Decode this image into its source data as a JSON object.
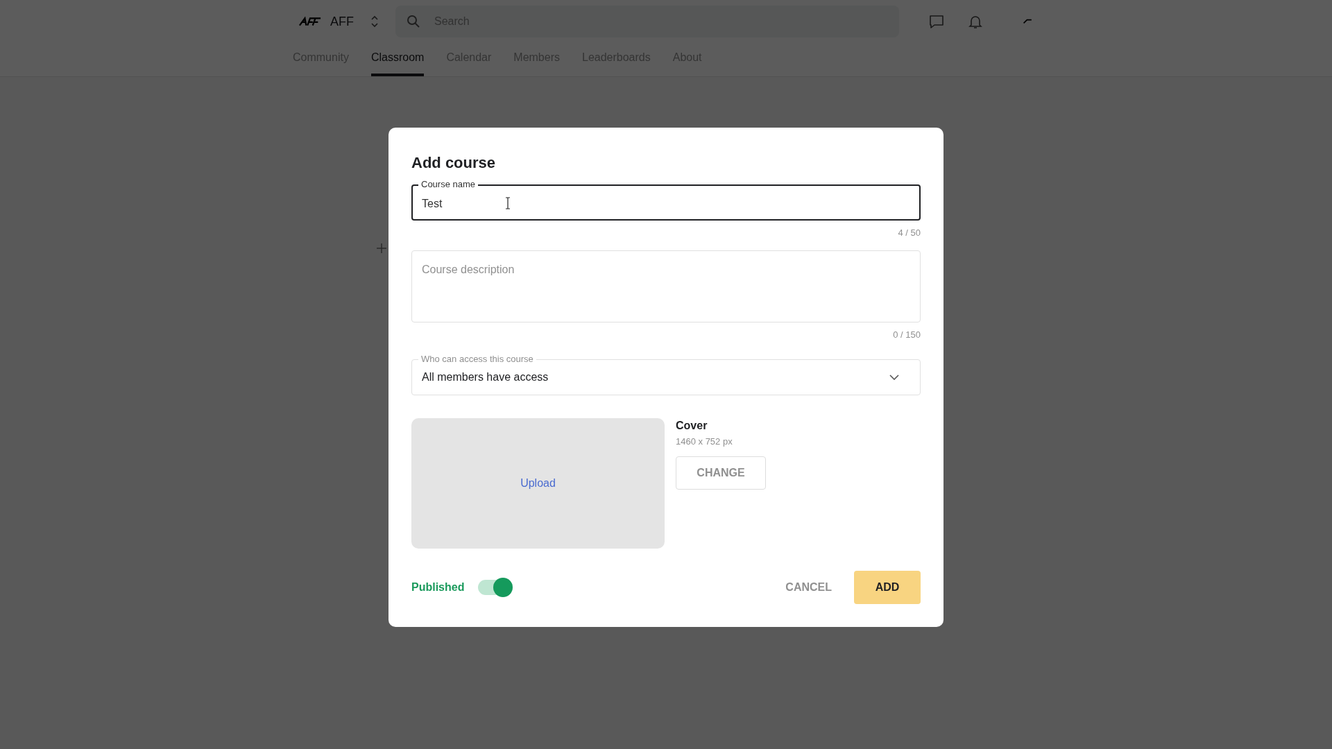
{
  "header": {
    "group_name": "AFF",
    "search": {
      "placeholder": "Search"
    }
  },
  "nav": [
    {
      "label": "Community",
      "selected": false
    },
    {
      "label": "Classroom",
      "selected": true
    },
    {
      "label": "Calendar",
      "selected": false
    },
    {
      "label": "Members",
      "selected": false
    },
    {
      "label": "Leaderboards",
      "selected": false
    },
    {
      "label": "About",
      "selected": false
    }
  ],
  "dialog": {
    "title": "Add course",
    "course_name": {
      "label": "Course name",
      "value": "Test",
      "counter": "4 / 50"
    },
    "description": {
      "placeholder": "Course description",
      "counter": "0 / 150"
    },
    "access": {
      "label": "Who can access this course",
      "value": "All members have access"
    },
    "cover": {
      "upload": "Upload",
      "title": "Cover",
      "size": "1460 x 752 px",
      "change": "CHANGE"
    },
    "published": {
      "label": "Published",
      "on": true
    },
    "buttons": [
      {
        "kind": "text",
        "label": "CANCEL"
      },
      {
        "kind": "primary",
        "label": "ADD"
      }
    ]
  }
}
